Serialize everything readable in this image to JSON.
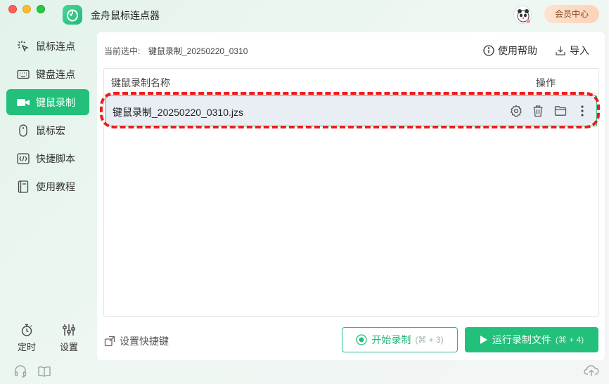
{
  "window": {
    "title": "金舟鼠标连点器",
    "vip_label": "会员中心"
  },
  "sidebar": {
    "items": [
      {
        "label": "鼠标连点",
        "icon": "cursor-click-icon"
      },
      {
        "label": "键盘连点",
        "icon": "keyboard-icon"
      },
      {
        "label": "键鼠录制",
        "icon": "video-camera-icon",
        "active": true
      },
      {
        "label": "鼠标宏",
        "icon": "mouse-icon"
      },
      {
        "label": "快捷脚本",
        "icon": "code-icon"
      },
      {
        "label": "使用教程",
        "icon": "book-icon"
      }
    ],
    "bottom": {
      "timer_label": "定时",
      "settings_label": "设置"
    },
    "footer_icons": [
      "headset-icon",
      "open-book-icon"
    ]
  },
  "main": {
    "selected_label": "当前选中:",
    "selected_value": "键鼠录制_20250220_0310",
    "help_label": "使用帮助",
    "import_label": "导入",
    "table": {
      "col_name": "键鼠录制名称",
      "col_ops": "操作",
      "rows": [
        {
          "name": "键鼠录制_20250220_0310.jzs"
        }
      ],
      "row_actions": [
        "gear-icon",
        "trash-icon",
        "folder-icon",
        "more-vertical-icon"
      ]
    },
    "shortcut_label": "设置快捷键",
    "start_button": {
      "label": "开始录制",
      "hotkey": "(⌘ + 3)"
    },
    "run_button": {
      "label": "运行录制文件",
      "hotkey": "(⌘ + 4)"
    }
  },
  "colors": {
    "accent": "#22c07b",
    "highlight": "#ee1c1c"
  }
}
